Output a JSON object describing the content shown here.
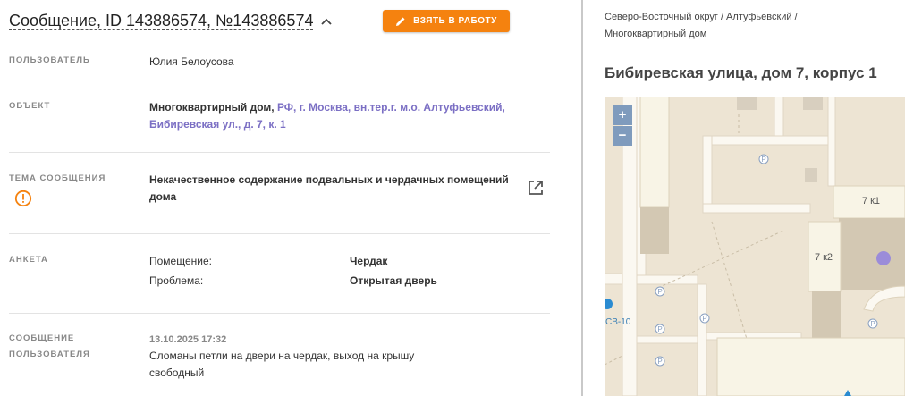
{
  "header": {
    "title": "Сообщение, ID 143886574, №143886574",
    "take_button_label": "ВЗЯТЬ В РАБОТУ"
  },
  "fields": {
    "user_label": "ПОЛЬЗОВАТЕЛЬ",
    "user_value": "Юлия Белоусова",
    "object_label": "ОБЪЕКТ",
    "object_type": "Многоквартирный дом,",
    "object_address_line1": "РФ, г. Москва, вн.тер.г. м.о. Алтуфьевский,",
    "object_address_line2": "Бибиревская ул., д. 7, к. 1",
    "topic_label": "ТЕМА СООБЩЕНИЯ",
    "topic_value_line1": "Некачественное содержание подвальных и чердачных помещений",
    "topic_value_line2": "дома",
    "survey_label": "АНКЕТА",
    "survey_rows": [
      {
        "key": "Помещение:",
        "value": "Чердак"
      },
      {
        "key": "Проблема:",
        "value": "Открытая дверь"
      }
    ],
    "message_label_line1": "СООБЩЕНИЕ",
    "message_label_line2": "ПОЛЬЗОВАТЕЛЯ",
    "message_date": "13.10.2025 17:32",
    "message_text_line1": "Сломаны петли на двери на чердак, выход на крышу",
    "message_text_line2": "свободный"
  },
  "right": {
    "breadcrumb_line1": "Северо-Восточный округ / Алтуфьевский /",
    "breadcrumb_line2": "Многоквартирный дом",
    "address_title": "Бибиревская улица, дом 7, корпус 1",
    "map": {
      "zoom_in": "+",
      "zoom_out": "−",
      "building_label_1": "7 к1",
      "building_label_2": "7 к2",
      "road_label": "СВ-10",
      "parking": "P",
      "marker_color": "#9b8cd9"
    }
  },
  "colors": {
    "accent": "#f5820f",
    "link": "#7b6fc4",
    "warning": "#f5820f"
  }
}
